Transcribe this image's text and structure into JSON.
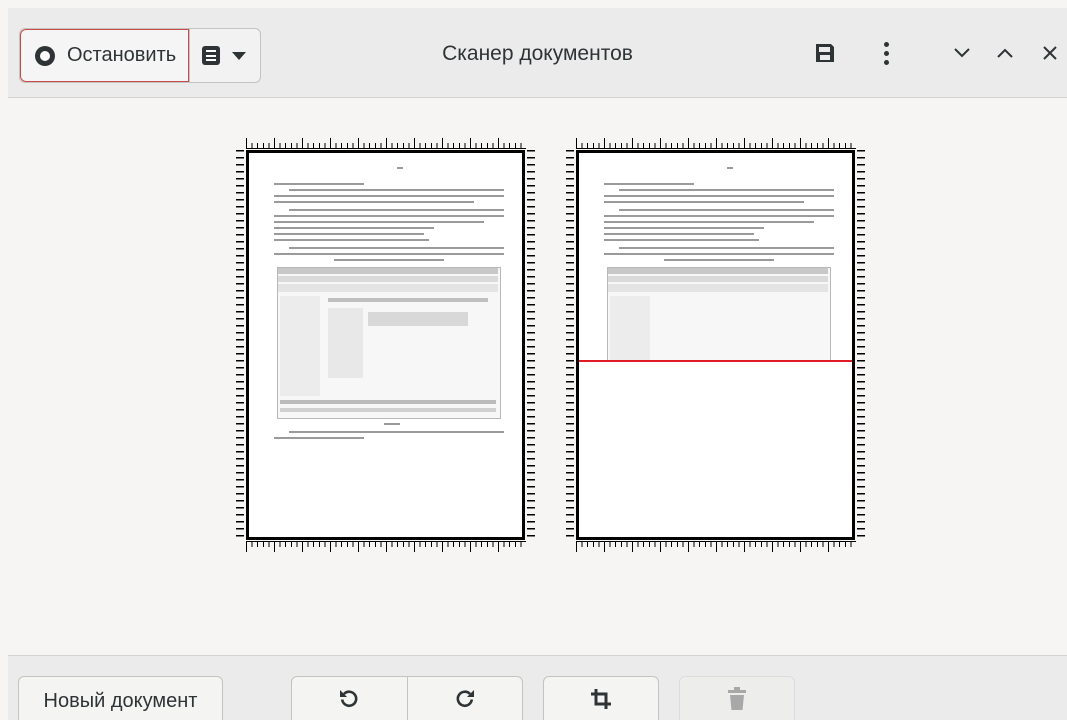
{
  "header": {
    "stop_label": "Остановить",
    "title": "Сканер документов",
    "icons": {
      "record": "record-icon",
      "document_menu": "document-menu-icon",
      "dropdown": "chevron-down-icon",
      "save": "save-icon",
      "more": "kebab-menu-icon",
      "minimize": "minimize-icon",
      "maximize": "maximize-icon",
      "close": "close-icon"
    }
  },
  "pages": [
    {
      "state": "scanned"
    },
    {
      "state": "scanning",
      "scan_progress": 0.54
    }
  ],
  "footer": {
    "new_document_label": "Новый документ",
    "icons": {
      "rotate_left": "rotate-left-icon",
      "rotate_right": "rotate-right-icon",
      "crop": "crop-icon",
      "delete": "trash-icon"
    },
    "delete_enabled": false
  },
  "colors": {
    "stop_border": "#c84a4a",
    "scan_line": "#e01b24",
    "headerbar": "#ebebeb"
  }
}
